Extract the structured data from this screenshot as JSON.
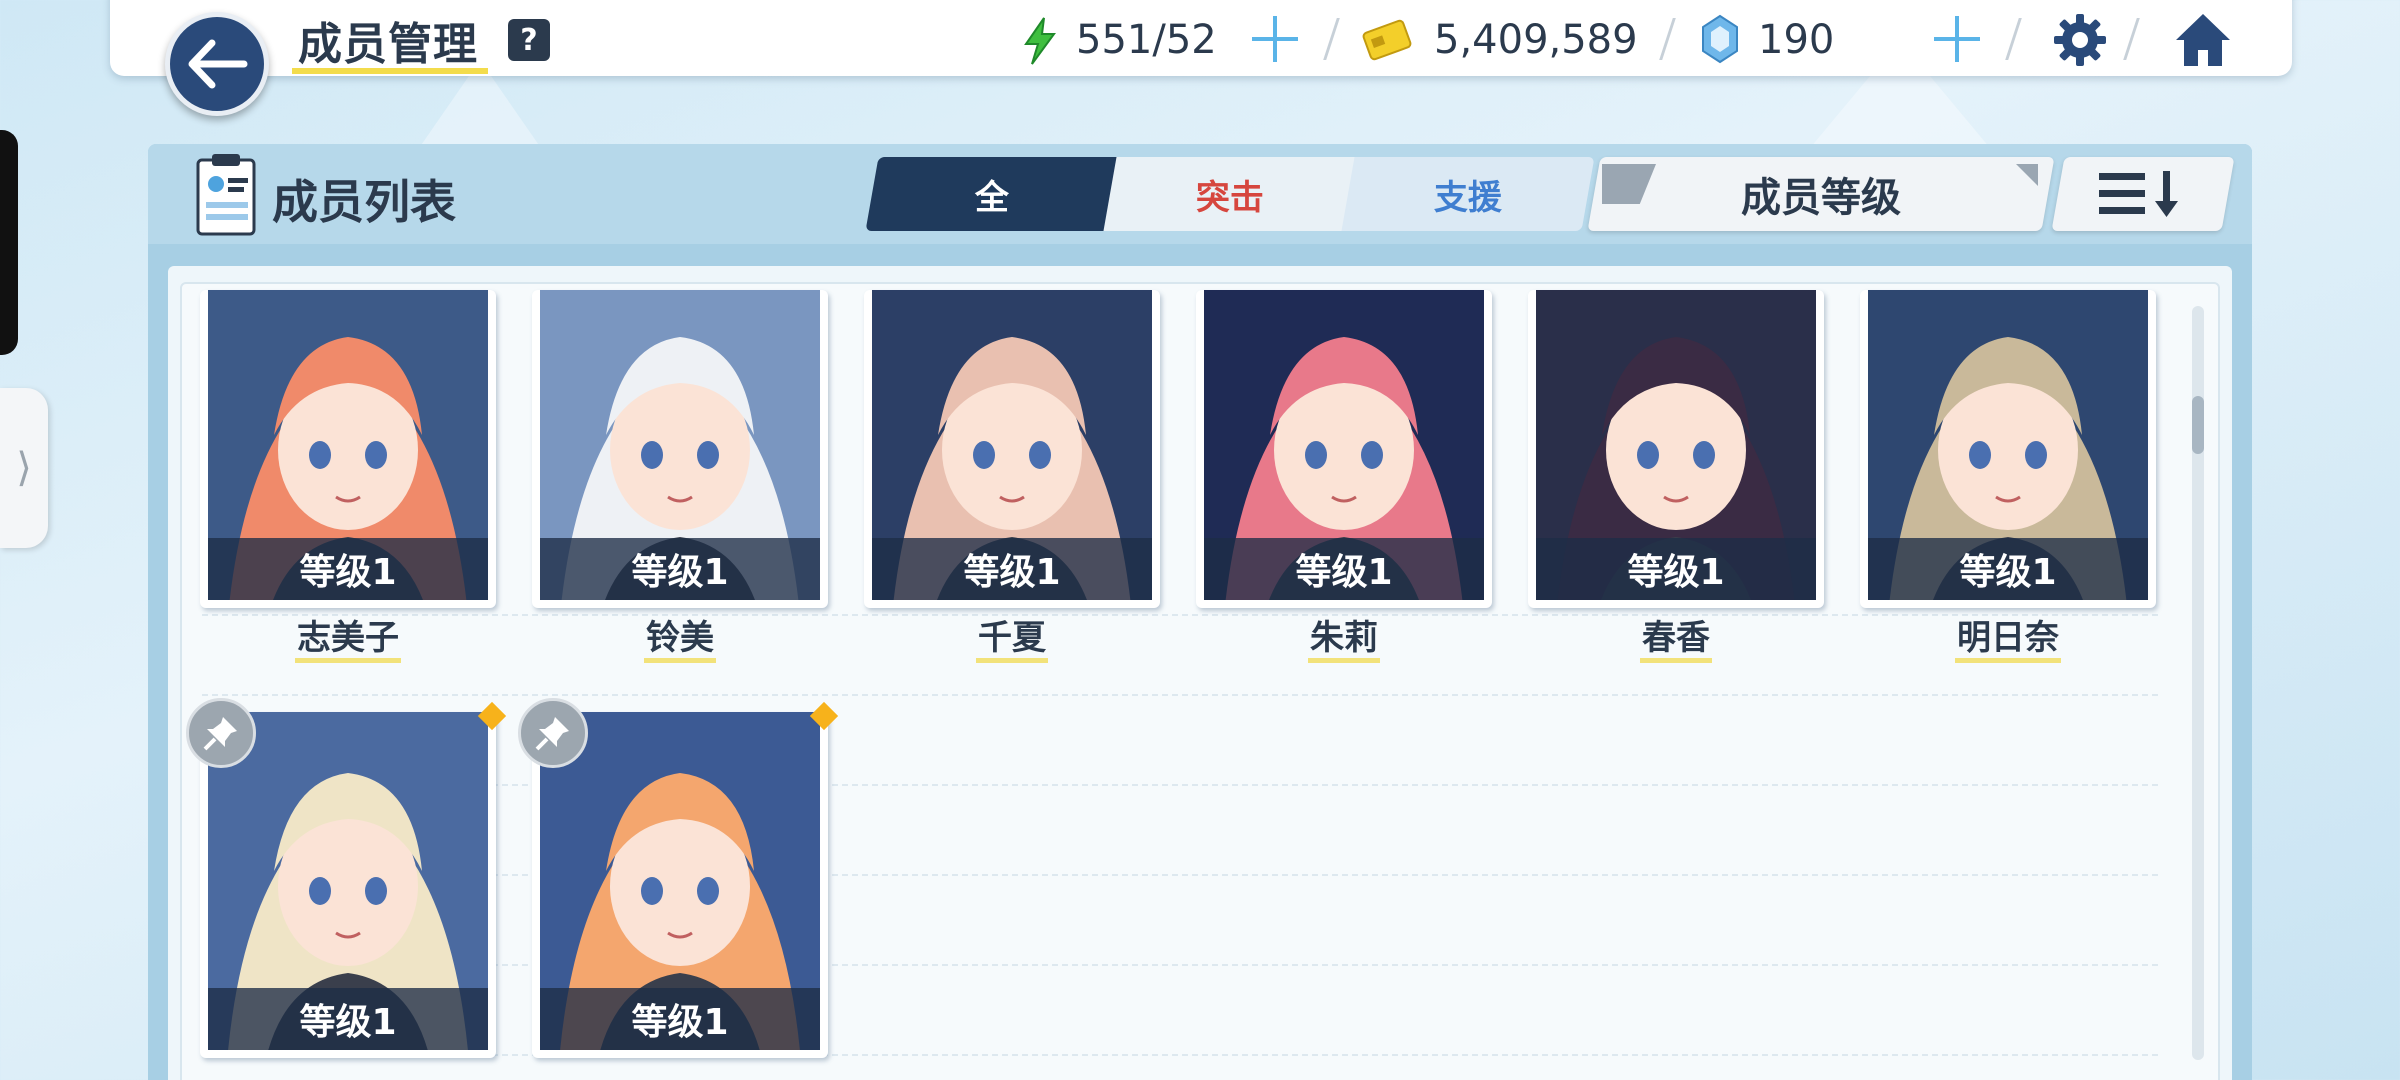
{
  "header": {
    "title": "成员管理",
    "help_label": "?",
    "stamina": "551/52",
    "credits": "5,409,589",
    "gems": "190"
  },
  "panel": {
    "title": "成员列表",
    "tabs": [
      {
        "label": "全",
        "active": true
      },
      {
        "label": "突击",
        "color": "#d6463e"
      },
      {
        "label": "支援",
        "color": "#3f7ed0"
      }
    ],
    "sort_label": "成员等级"
  },
  "members": [
    {
      "level": "等级1",
      "name": "志美子",
      "hair": "#f08a6a",
      "bg": "#3d5a88"
    },
    {
      "level": "等级1",
      "name": "铃美",
      "hair": "#eef1f5",
      "bg": "#7a96c0"
    },
    {
      "level": "等级1",
      "name": "千夏",
      "hair": "#e9c0b0",
      "bg": "#2c3f66"
    },
    {
      "level": "等级1",
      "name": "朱莉",
      "hair": "#e8798a",
      "bg": "#1f2b55"
    },
    {
      "level": "等级1",
      "name": "春香",
      "hair": "#3a2b44",
      "bg": "#2a2f4a"
    },
    {
      "level": "等级1",
      "name": "明日奈",
      "hair": "#c9b99a",
      "bg": "#2e4770"
    },
    {
      "level": "等级1",
      "name": "",
      "hair": "#efe4c6",
      "bg": "#4b6aa0"
    },
    {
      "level": "等级1",
      "name": "",
      "hair": "#f4a66e",
      "bg": "#3c5a94"
    }
  ]
}
